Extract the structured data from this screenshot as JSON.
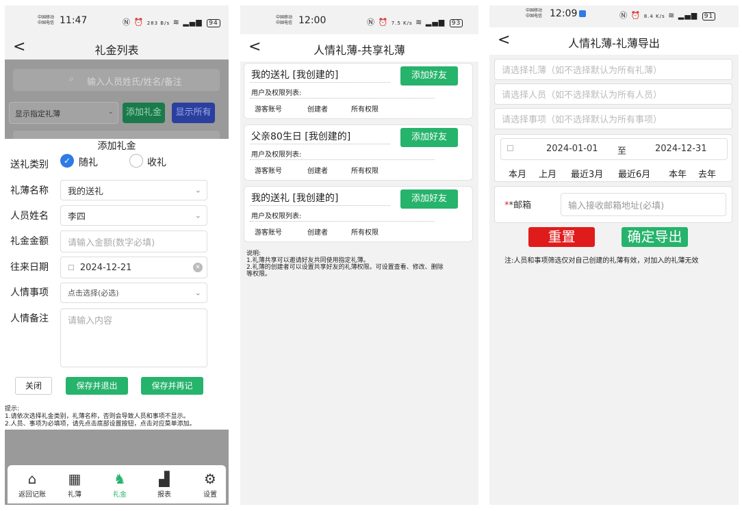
{
  "panel1": {
    "status": {
      "carrier1": "中国移动",
      "carrier2": "中国电信",
      "time": "11:47",
      "net_speed": "283 B/s",
      "battery": "94"
    },
    "nav": {
      "back": "<",
      "title": "礼金列表"
    },
    "background": {
      "search_placeholder": "输入人员姓氏/姓名/备注",
      "filter_select": "显示指定礼薄",
      "add_button": "添加礼金",
      "show_all_button": "显示所有"
    },
    "dialog": {
      "title": "添加礼金",
      "category_label": "送礼类别",
      "option_give": "随礼",
      "option_receive": "收礼",
      "book_label": "礼薄名称",
      "book_value": "我的送礼",
      "person_label": "人员姓名",
      "person_value": "李四",
      "amount_label": "礼金金额",
      "amount_placeholder": "请输入金额(数字必填)",
      "date_label": "往来日期",
      "date_value": "2024-12-21",
      "event_label": "人情事项",
      "event_placeholder": "点击选择(必选)",
      "remark_label": "人情备注",
      "remark_placeholder": "请输入内容",
      "close_button": "关闭",
      "save_exit_button": "保存并退出",
      "save_again_button": "保存并再记",
      "tips": [
        "提示:",
        "1.请依次选择礼金类别，礼薄名称，否则会导致人员和事项不显示。",
        "2.人员、事项为必填项，请先点击底部设置按钮，点击对应菜单添加。"
      ]
    },
    "tabbar": [
      {
        "label": "返回记账",
        "icon": "home-icon"
      },
      {
        "label": "礼薄",
        "icon": "grid-icon"
      },
      {
        "label": "礼金",
        "icon": "money-bag-icon"
      },
      {
        "label": "报表",
        "icon": "chart-icon"
      },
      {
        "label": "设置",
        "icon": "gear-icon"
      }
    ]
  },
  "panel2": {
    "status": {
      "carrier1": "中国移动",
      "carrier2": "中国电信",
      "time": "12:00",
      "net_speed": "7.5 K/s",
      "battery": "93"
    },
    "nav": {
      "back": "<",
      "title": "人情礼薄-共享礼薄"
    },
    "cards": [
      {
        "title": "我的送礼 [我创建的]",
        "button": "添加好友",
        "subtitle": "用户及权限列表:",
        "cols": [
          "游客账号",
          "创建者",
          "所有权限"
        ]
      },
      {
        "title": "父亲80生日 [我创建的]",
        "button": "添加好友",
        "subtitle": "用户及权限列表:",
        "cols": [
          "游客账号",
          "创建者",
          "所有权限"
        ]
      },
      {
        "title": "我的送礼 [我创建的]",
        "button": "添加好友",
        "subtitle": "用户及权限列表:",
        "cols": [
          "游客账号",
          "创建者",
          "所有权限"
        ]
      }
    ],
    "notes": [
      "说明:",
      "1.礼薄共享可以邀请好友共同使用指定礼薄。",
      "2.礼薄的创建者可以设置共享好友的礼薄权限。可设置查看、修改、删除",
      "等权限。"
    ]
  },
  "panel3": {
    "status": {
      "carrier1": "中国移动",
      "carrier2": "中国电信",
      "time": "12:09",
      "net_speed": "8.4 K/s",
      "battery": "91"
    },
    "nav": {
      "back": "<",
      "title": "人情礼薄-礼薄导出"
    },
    "select_book": "请选择礼薄（如不选择默认为所有礼薄）",
    "select_person": "请选择人员（如不选择默认为所有人员）",
    "select_event": "请选择事项（如不选择默认为所有事项）",
    "date_from": "2024-01-01",
    "date_to_label": "至",
    "date_to": "2024-12-31",
    "quick_ranges": [
      "本月",
      "上月",
      "最近3月",
      "最近6月",
      "本年",
      "去年"
    ],
    "email_label": "*邮箱",
    "email_placeholder": "输入接收邮箱地址(必填)",
    "reset_button": "重置",
    "export_button": "确定导出",
    "note": "注:人员和事项筛选仅对自己创建的礼薄有效，对加入的礼薄无效"
  }
}
